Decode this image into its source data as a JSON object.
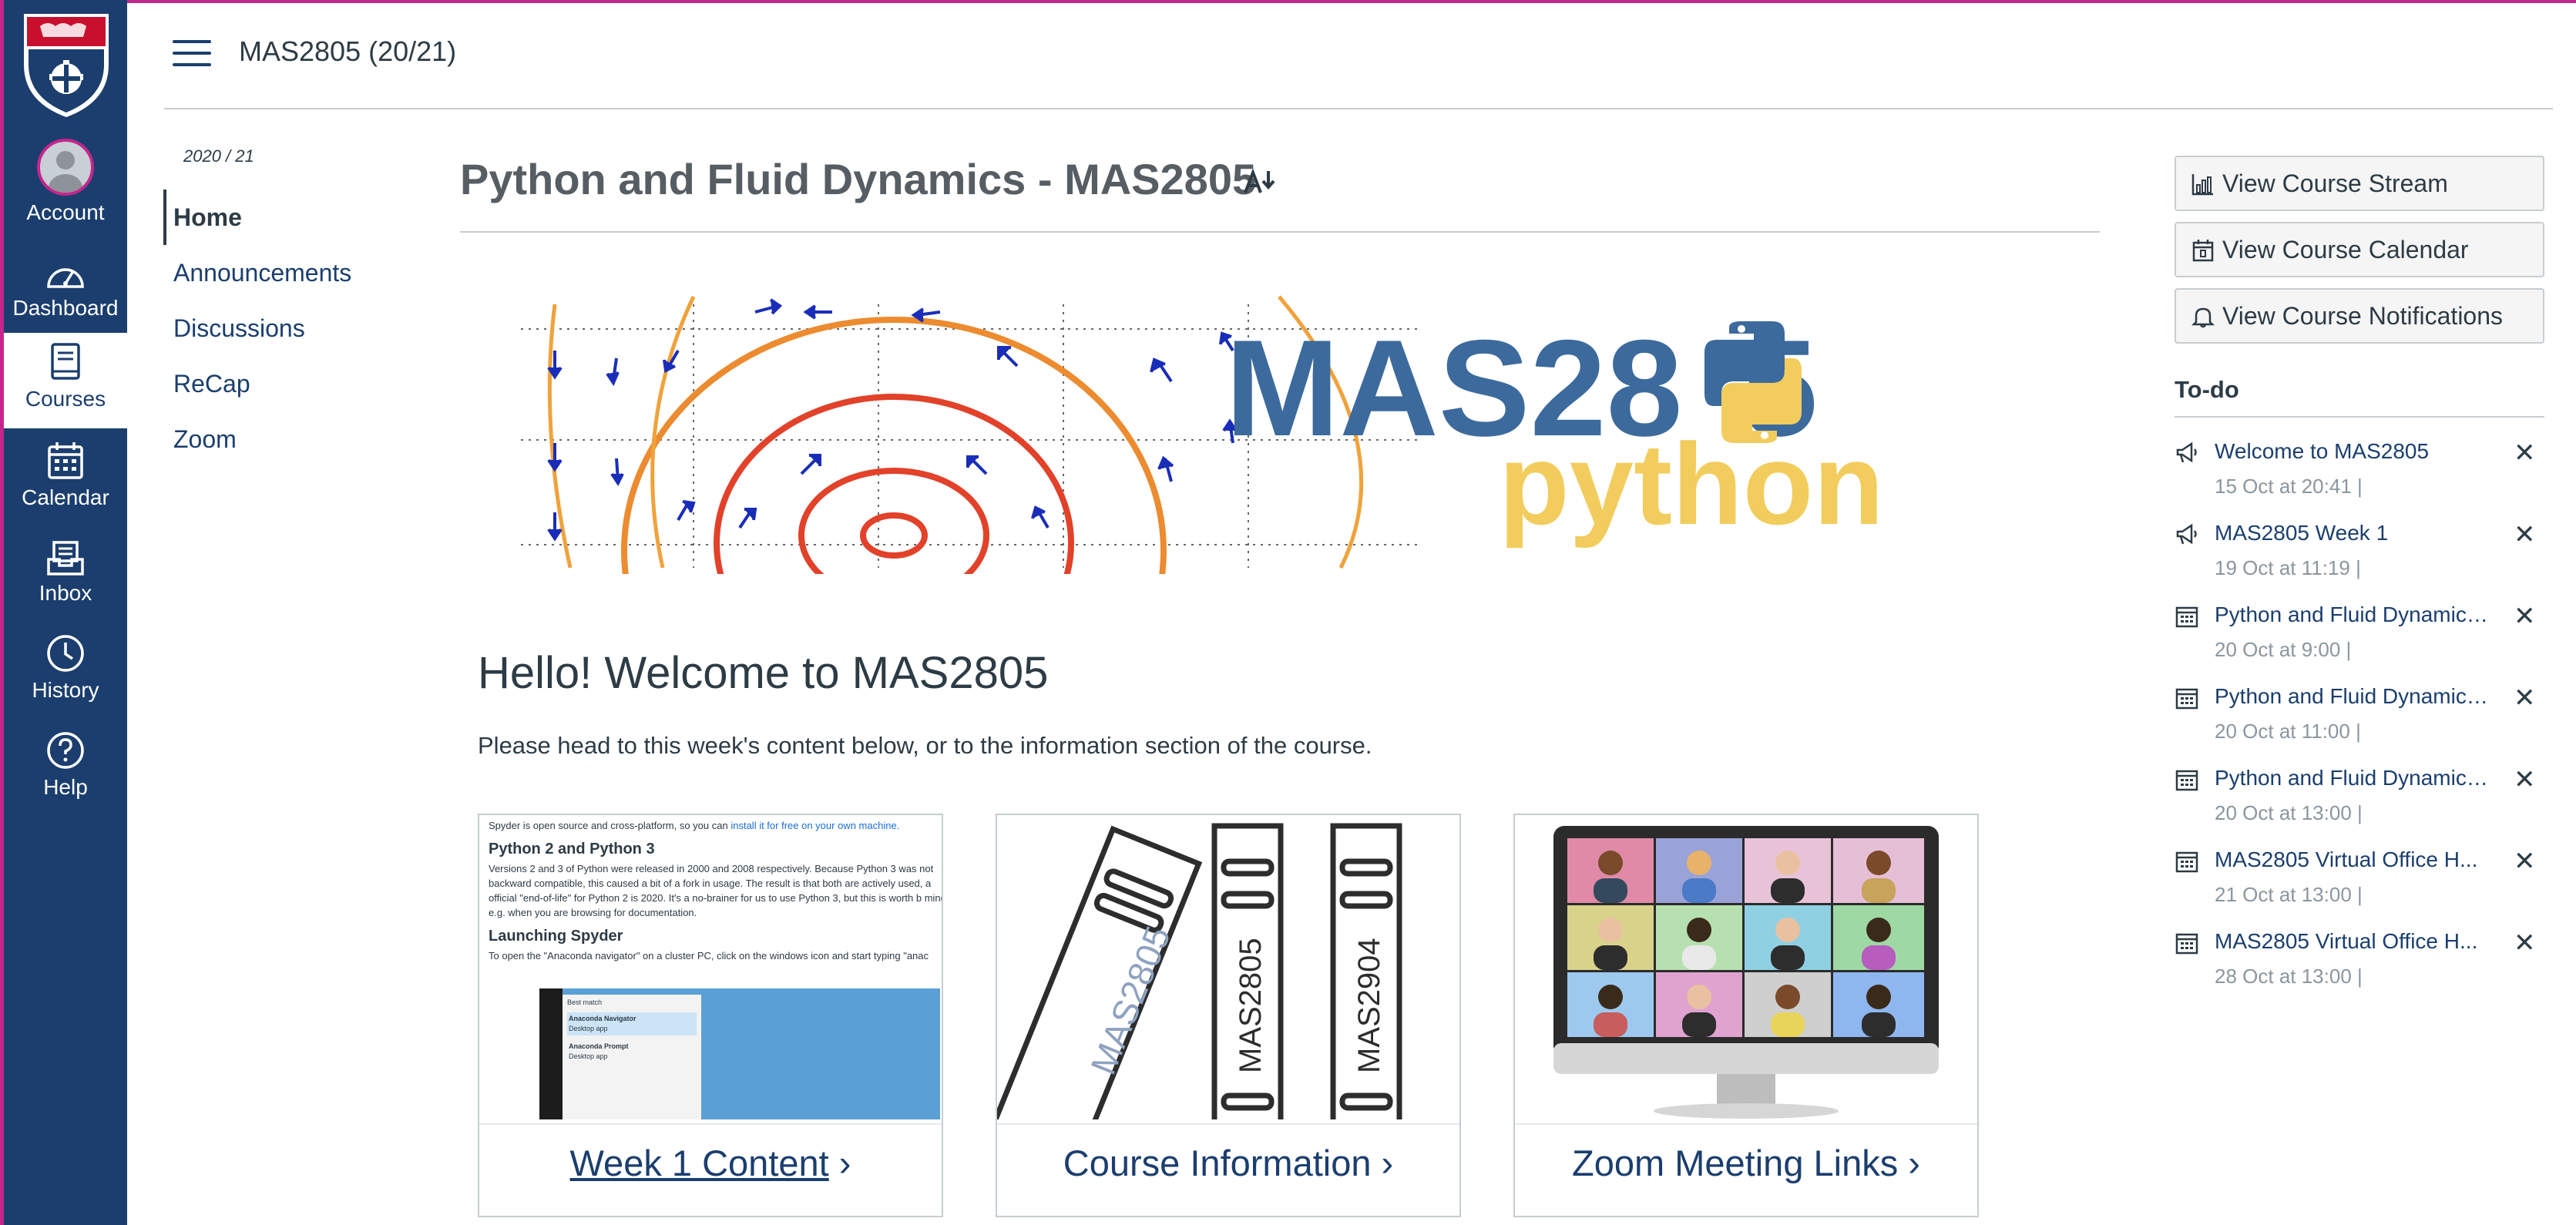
{
  "global_nav": {
    "items": [
      {
        "label": "Account"
      },
      {
        "label": "Dashboard"
      },
      {
        "label": "Courses"
      },
      {
        "label": "Calendar"
      },
      {
        "label": "Inbox"
      },
      {
        "label": "History"
      },
      {
        "label": "Help"
      }
    ]
  },
  "header": {
    "breadcrumb": "MAS2805 (20/21)"
  },
  "course_nav": {
    "term": "2020 / 21",
    "items": [
      {
        "label": "Home"
      },
      {
        "label": "Announcements"
      },
      {
        "label": "Discussions"
      },
      {
        "label": "ReCap"
      },
      {
        "label": "Zoom"
      }
    ]
  },
  "main": {
    "title": "Python and Fluid Dynamics - MAS2805",
    "banner": {
      "code_left": "MAS28",
      "code_right": "5",
      "word": "python"
    },
    "heading": "Hello! Welcome to MAS2805",
    "intro": "Please head to this week's content below, or to the information section of the course.",
    "cards": [
      {
        "label": "Week 1 Content",
        "chevron": "›"
      },
      {
        "label": "Course Information",
        "chevron": "›"
      },
      {
        "label": "Zoom Meeting Links",
        "chevron": "›"
      }
    ],
    "week1_thumb": {
      "line1": "Spyder is open source and cross-platform, so you can",
      "line1_link": "install it for free on your own machine.",
      "h1": "Python 2 and Python 3",
      "p1": "Versions 2 and 3 of Python were released in 2000 and 2008 respectively. Because Python 3 was not backward compatible, this caused a bit of a fork in usage. The result is that both are actively used, a official \"end-of-life\" for Python 2 is 2020. It's a no-brainer for us to use Python 3, but this is worth b mind e.g. when you are browsing for documentation.",
      "h2": "Launching Spyder",
      "p2": "To open the \"Anaconda navigator\" on a cluster PC, click on the windows icon and start typing \"anac",
      "menu_title": "Best match",
      "menu_item1": "Anaconda Navigator",
      "menu_item1_sub": "Desktop app",
      "menu_item2": "Anaconda Prompt",
      "menu_item2_sub": "Desktop app"
    },
    "binder_labels": [
      "MAS2805",
      "MAS2805",
      "MAS2904"
    ]
  },
  "right": {
    "buttons": [
      {
        "label": "View Course Stream"
      },
      {
        "label": "View Course Calendar"
      },
      {
        "label": "View Course Notifications"
      }
    ],
    "todo_title": "To-do",
    "todos": [
      {
        "icon": "announcement-icon",
        "title": "Welcome to MAS2805",
        "date": "15 Oct at 20:41  |"
      },
      {
        "icon": "announcement-icon",
        "title": "MAS2805 Week 1",
        "date": "19 Oct at 11:19  |"
      },
      {
        "icon": "calendar-icon",
        "title": "Python and Fluid Dynamics...",
        "date": "20 Oct at 9:00  |"
      },
      {
        "icon": "calendar-icon",
        "title": "Python and Fluid Dynamics...",
        "date": "20 Oct at 11:00  |"
      },
      {
        "icon": "calendar-icon",
        "title": "Python and Fluid Dynamics...",
        "date": "20 Oct at 13:00  |"
      },
      {
        "icon": "calendar-icon",
        "title": "MAS2805 Virtual Office H...",
        "date": "21 Oct at 13:00  |"
      },
      {
        "icon": "calendar-icon",
        "title": "MAS2805 Virtual Office H...",
        "date": "28 Oct at 13:00  |"
      }
    ],
    "dismiss": "✕"
  },
  "colors": {
    "nav_bg": "#1b3e6e",
    "accent": "#c4268c",
    "link": "#1b3e6e",
    "python_blue": "#3c6a9c",
    "python_yellow": "#f2cd5d"
  }
}
